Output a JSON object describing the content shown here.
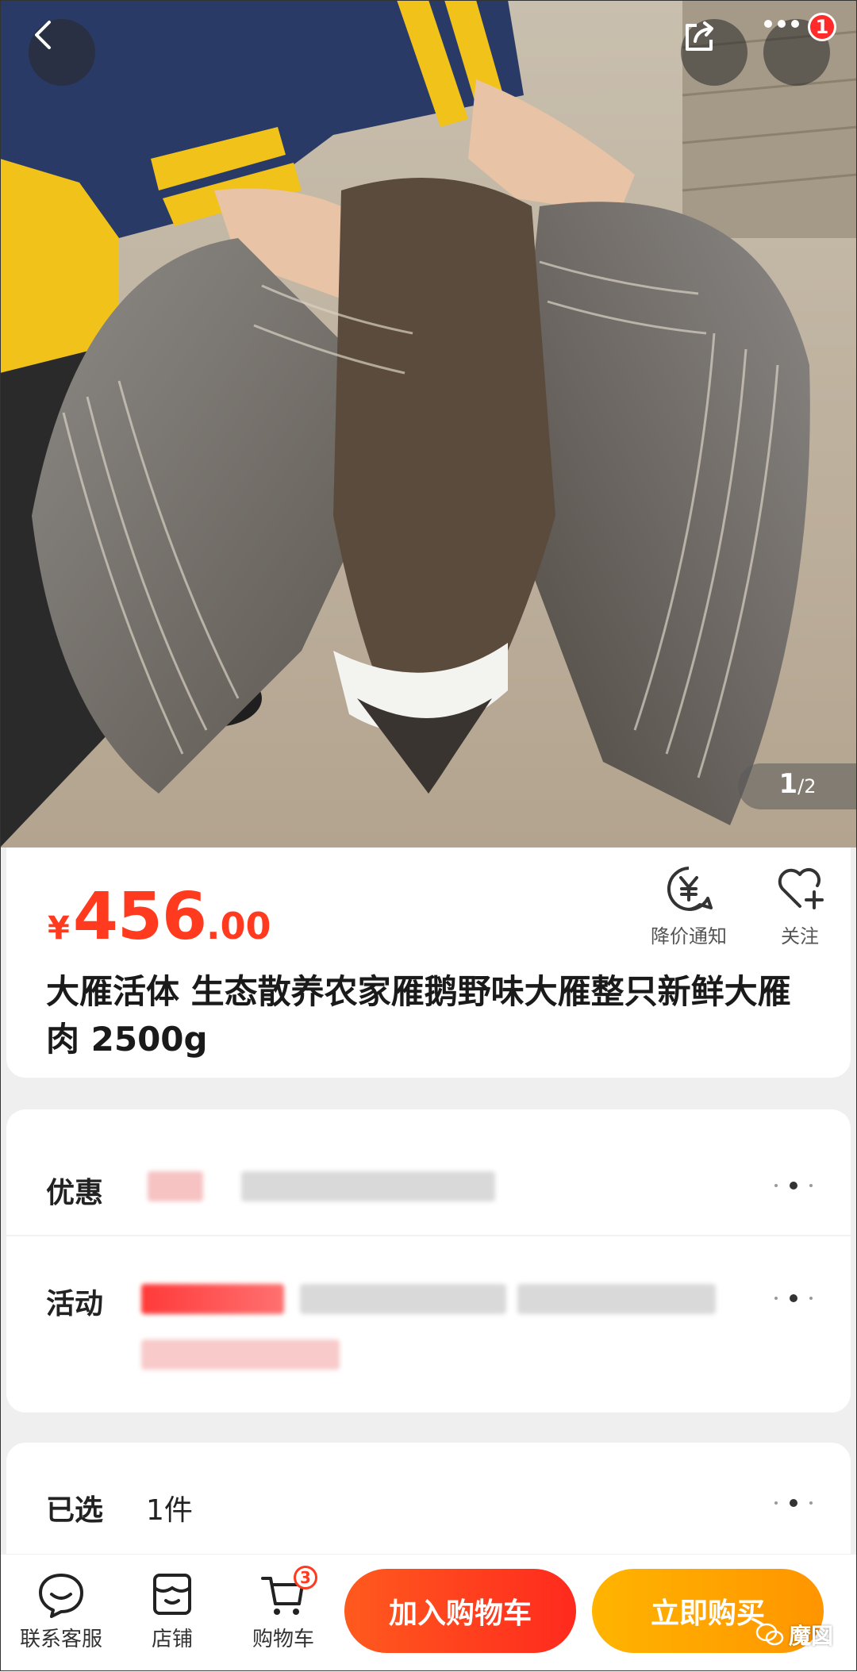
{
  "gallery": {
    "current": "1",
    "total": "/2",
    "more_badge": "1"
  },
  "product": {
    "currency": "¥",
    "price_int": "456",
    "price_dec": ".00",
    "title": "大雁活体 生态散养农家雁鹅野味大雁整只新鲜大雁肉 2500g",
    "price_color": "#ff3a1e"
  },
  "actions": {
    "notify_label": "降价通知",
    "follow_label": "关注"
  },
  "promo": {
    "discount_label": "优惠",
    "activity_label": "活动"
  },
  "selection": {
    "label": "已选",
    "value": "1件"
  },
  "bottom_bar": {
    "service_label": "联系客服",
    "shop_label": "店铺",
    "cart_label": "购物车",
    "cart_count": "3",
    "add_to_cart": "加入购物车",
    "buy_now": "立即购买"
  },
  "watermark": {
    "text": "魔図"
  }
}
